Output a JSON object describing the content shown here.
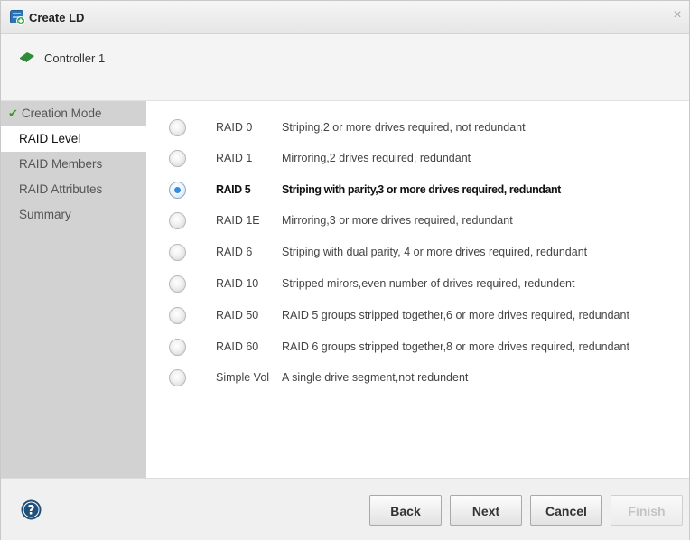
{
  "window": {
    "title": "Create LD",
    "close_glyph": "×"
  },
  "controller": {
    "label": "Controller 1",
    "icon": "controller-card-icon",
    "icon_color": "#2e8b3a"
  },
  "sidebar": {
    "items": [
      {
        "label": "Creation Mode",
        "state": "done",
        "check": "✔"
      },
      {
        "label": "RAID Level",
        "state": "active"
      },
      {
        "label": "RAID Members",
        "state": "pending"
      },
      {
        "label": "RAID Attributes",
        "state": "pending"
      },
      {
        "label": "Summary",
        "state": "pending"
      }
    ]
  },
  "raid_options": [
    {
      "level": "RAID 0",
      "description": "Striping,2 or more drives required, not redundant",
      "selected": false
    },
    {
      "level": "RAID 1",
      "description": "Mirroring,2 drives required, redundant",
      "selected": false
    },
    {
      "level": "RAID 5",
      "description": "Striping with parity,3 or more drives required, redundant",
      "selected": true
    },
    {
      "level": "RAID 1E",
      "description": "Mirroring,3 or more drives required, redundant",
      "selected": false
    },
    {
      "level": "RAID 6",
      "description": "Striping with dual parity, 4 or more drives required, redundant",
      "selected": false
    },
    {
      "level": "RAID 10",
      "description": "Stripped mirors,even number of drives required, redundent",
      "selected": false
    },
    {
      "level": "RAID 50",
      "description": "RAID 5 groups stripped together,6 or more drives required, redundant",
      "selected": false
    },
    {
      "level": "RAID 60",
      "description": "RAID 6 groups stripped together,8 or more drives required, redundant",
      "selected": false
    },
    {
      "level": "Simple Vol",
      "description": "A single drive segment,not redundent",
      "selected": false
    }
  ],
  "footer": {
    "help_icon": "help-icon",
    "help_glyph": "?",
    "buttons": {
      "back": "Back",
      "next": "Next",
      "cancel": "Cancel",
      "finish": "Finish"
    },
    "finish_enabled": false
  },
  "colors": {
    "accent": "#2f8de4",
    "check": "#3a9a1a",
    "sidebar_bg": "#d2d2d2",
    "help_icon": "#1f4f7a"
  }
}
